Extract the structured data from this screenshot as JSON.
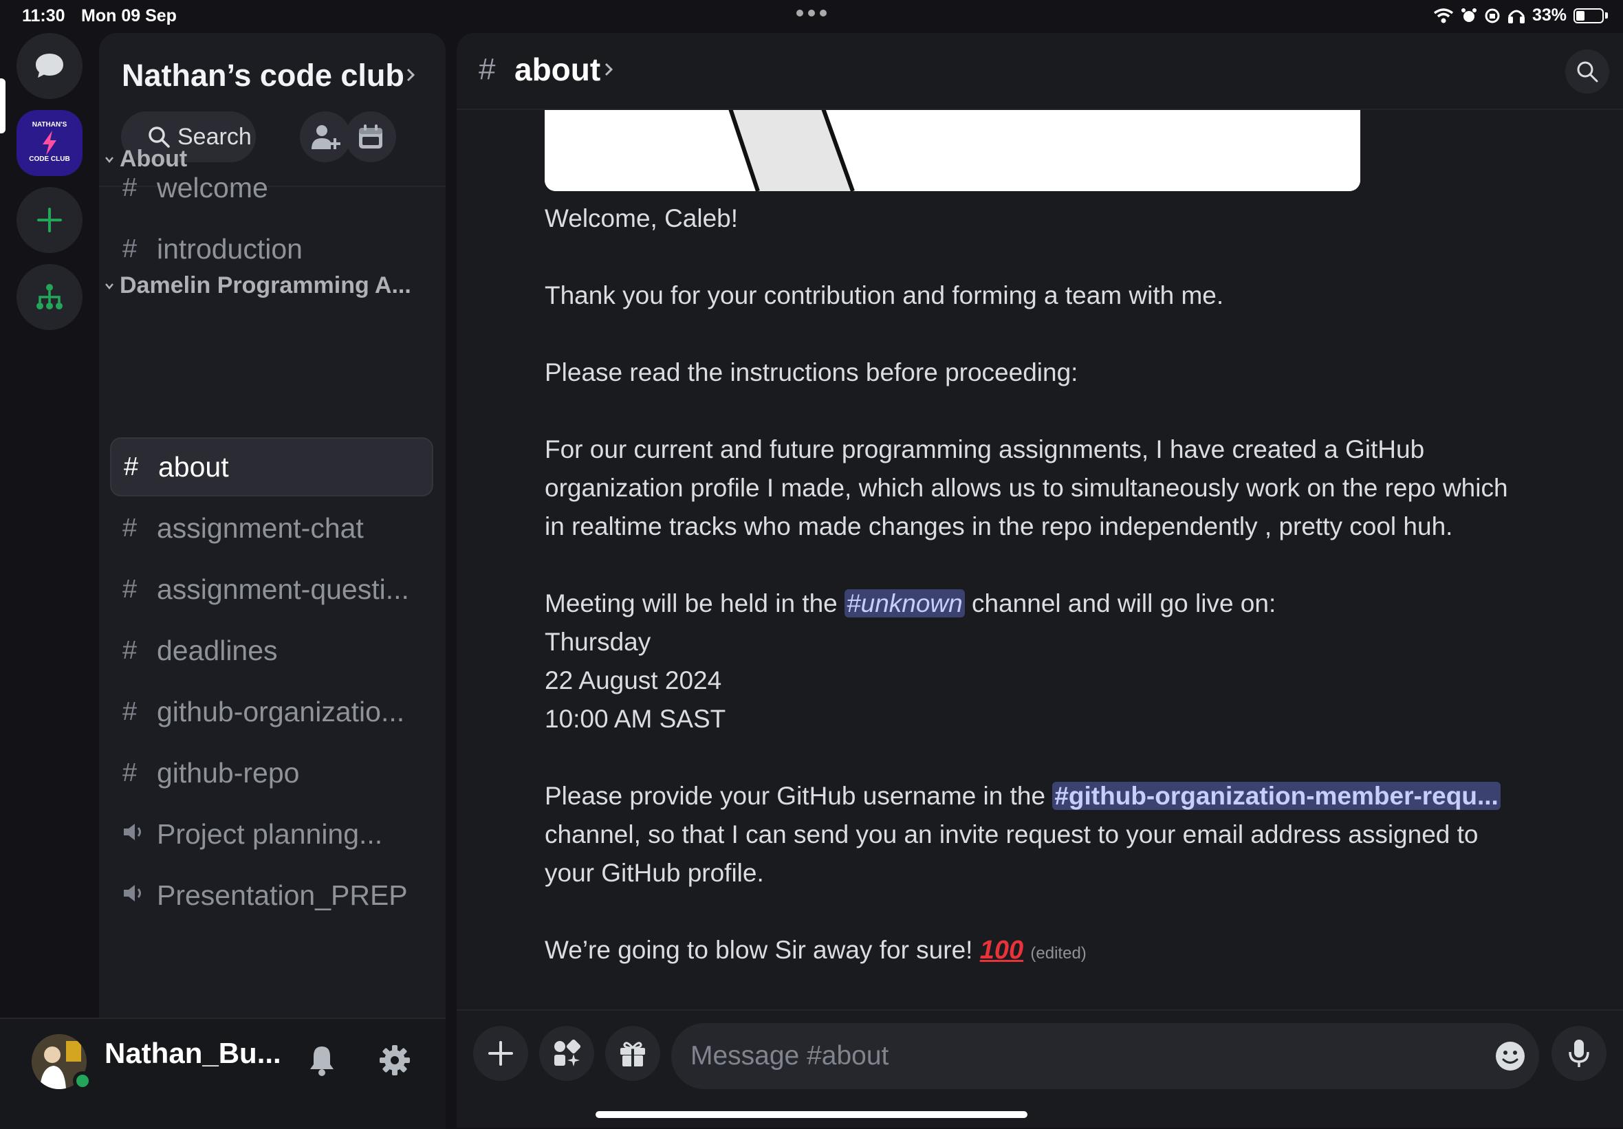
{
  "status_bar": {
    "time": "11:30",
    "date": "Mon 09 Sep",
    "battery": "33%",
    "battery_level": 0.33
  },
  "rail": {
    "items": [
      "direct-messages-icon",
      "server-nathans-code-club",
      "add-server-icon",
      "discover-servers-icon"
    ],
    "server_logo_top": "NATHAN'S",
    "server_logo_bottom": "CODE CLUB"
  },
  "server": {
    "name": "Nathan’s code club",
    "search_label": "Search"
  },
  "categories": [
    {
      "name": "About",
      "channels": [
        {
          "name": "welcome",
          "type": "text"
        },
        {
          "name": "introduction",
          "type": "text"
        }
      ]
    },
    {
      "name": "Damelin Programming A...",
      "channels": [
        {
          "name": "about",
          "type": "text",
          "active": true
        },
        {
          "name": "assignment-chat",
          "type": "text"
        },
        {
          "name": "assignment-questi...",
          "type": "text"
        },
        {
          "name": "deadlines",
          "type": "text"
        },
        {
          "name": "github-organizatio...",
          "type": "text"
        },
        {
          "name": "github-repo",
          "type": "text"
        },
        {
          "name": "Project planning...",
          "type": "voice"
        },
        {
          "name": "Presentation_PREP",
          "type": "voice"
        }
      ]
    }
  ],
  "user": {
    "name": "Nathan_Bu...",
    "status": "online"
  },
  "channel_header": {
    "hash": "#",
    "title": "about"
  },
  "message": {
    "welcome": "Welcome, Caleb!",
    "thanks": "Thank you for your contribution and forming a team with me.",
    "instructions": "Please read the instructions before proceeding:",
    "github_line1": "For our current and future programming assignments, I have created a GitHub",
    "github_line2": "organization profile I made, which allows us to simultaneously work on the repo which",
    "github_line3": "in realtime tracks who made changes in the repo independently , pretty cool huh.",
    "meeting_prefix": "Meeting will be held in the",
    "meeting_mention": "#unknown",
    "meeting_suffix": "channel and will go live on:",
    "day": "Thursday",
    "date": "22 August 2024",
    "time": "10:00 AM SAST",
    "provide_prefix": "Please provide your GitHub username in the",
    "provide_mention": "#github-organization-member-requ...",
    "provide_line2": "channel, so that I can send you an invite request to your email address assigned to",
    "provide_line3": "your GitHub profile.",
    "closing": "We’re going to blow Sir away for sure!",
    "closing_emoji": "100",
    "edited": "(edited)"
  },
  "composer": {
    "placeholder": "Message #about"
  },
  "colors": {
    "accent_green": "#23a55a",
    "mention_bg": "#3c4270",
    "background": "#1a1b1f"
  }
}
